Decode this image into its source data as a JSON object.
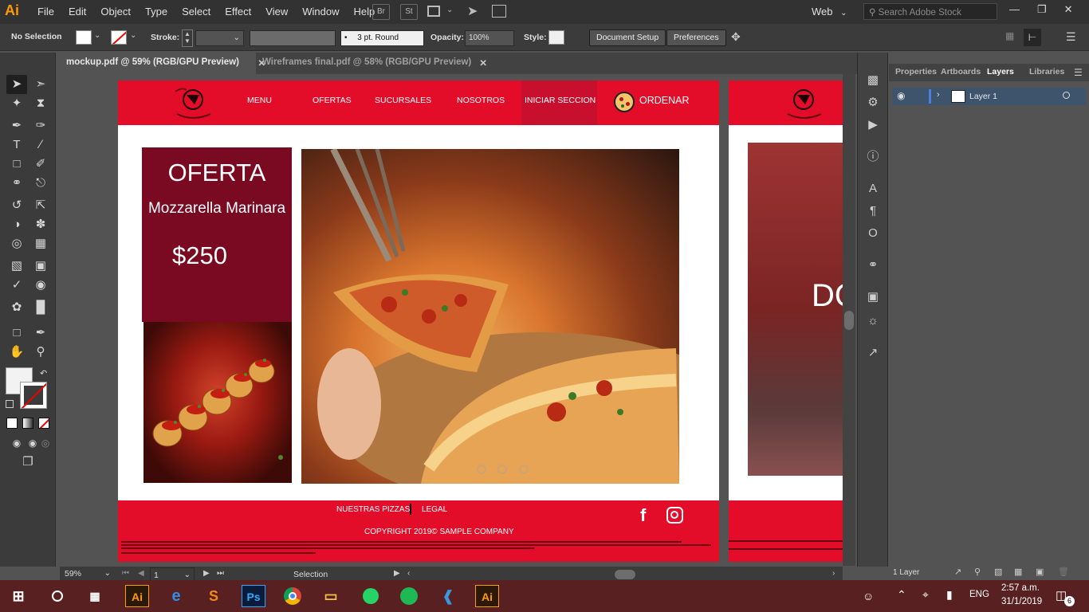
{
  "app": {
    "logo": "Ai",
    "menu": [
      "File",
      "Edit",
      "Object",
      "Type",
      "Select",
      "Effect",
      "View",
      "Window",
      "Help"
    ],
    "bridge_icons": [
      "Br",
      "St"
    ],
    "workspace": "Web",
    "search_placeholder": "Search Adobe Stock"
  },
  "control": {
    "selection": "No Selection",
    "stroke_label": "Stroke:",
    "brush": "3 pt. Round",
    "opacity_label": "Opacity:",
    "opacity_value": "100%",
    "style_label": "Style:",
    "document_setup": "Document Setup",
    "preferences": "Preferences"
  },
  "tabs": [
    {
      "label": "mockup.pdf @ 59% (RGB/GPU Preview)"
    },
    {
      "label": "Wireframes final.pdf @ 58% (RGB/GPU Preview)"
    }
  ],
  "artboard": {
    "nav": [
      "MENU",
      "OFERTAS",
      "SUCURSALES",
      "NOSOTROS",
      "INICIAR SECCION"
    ],
    "order": "ORDENAR",
    "offer_title": "OFERTA",
    "offer_item": "Mozzarella Marinara",
    "offer_price": "$250",
    "footer_links": [
      "NUESTRAS PIZZAS",
      "LEGAL"
    ],
    "copyright": "COPYRIGHT 2019© SAMPLE COMPANY",
    "partial_text": "DO"
  },
  "panel": {
    "tabs": [
      "Properties",
      "Artboards",
      "Layers",
      "Libraries"
    ],
    "layer_name": "Layer 1",
    "layer_count": "1 Layer"
  },
  "status": {
    "zoom": "59%",
    "page": "1",
    "tool": "Selection"
  },
  "taskbar": {
    "language": "ENG",
    "time": "2:57 a.m.",
    "date": "31/1/2019",
    "notifications": "6"
  },
  "colors": {
    "brand_red": "#e30d2a",
    "offer_box": "#7a0a22",
    "login_bg": "#c8102e"
  }
}
